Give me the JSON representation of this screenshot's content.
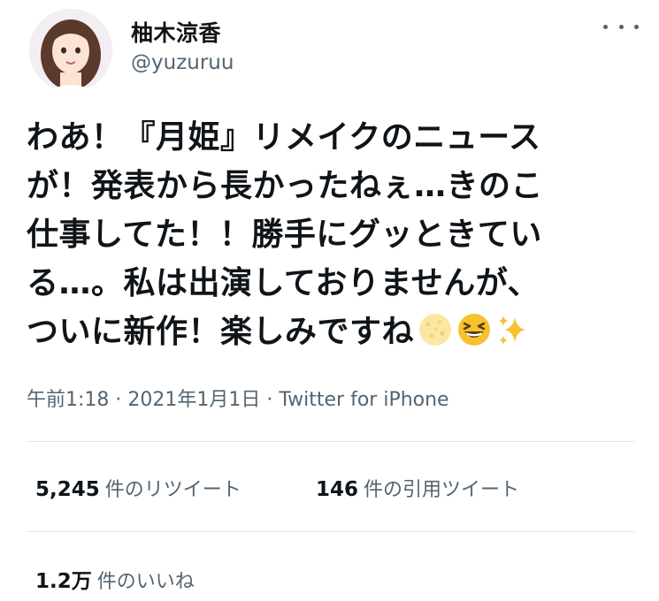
{
  "user": {
    "name": "柚木涼香",
    "handle": "@yuzuruu"
  },
  "tweet": {
    "lines": [
      "わあ！『月姫』リメイクのニュース",
      "が！発表から長かったねぇ…きのこ",
      "仕事してた！！勝手にグッときてい",
      "る…。私は出演しておりませんが、",
      "ついに新作！楽しみですね"
    ],
    "emojis": [
      "full-moon-face-emoji",
      "grinning-squinting-face-emoji",
      "sparkles-emoji"
    ]
  },
  "meta": {
    "time": "午前1:18",
    "sep1": " · ",
    "date": "2021年1月1日",
    "sep2": " · ",
    "source": "Twitter for iPhone"
  },
  "stats": {
    "retweets_count": "5,245",
    "retweets_label": "件のリツイート",
    "quotes_count": "146",
    "quotes_label": "件の引用ツイート",
    "likes_count": "1.2万",
    "likes_label": "件のいいね"
  },
  "colors": {
    "text": "#0f1419",
    "secondary": "#536471",
    "divider": "#e1e5e8"
  }
}
